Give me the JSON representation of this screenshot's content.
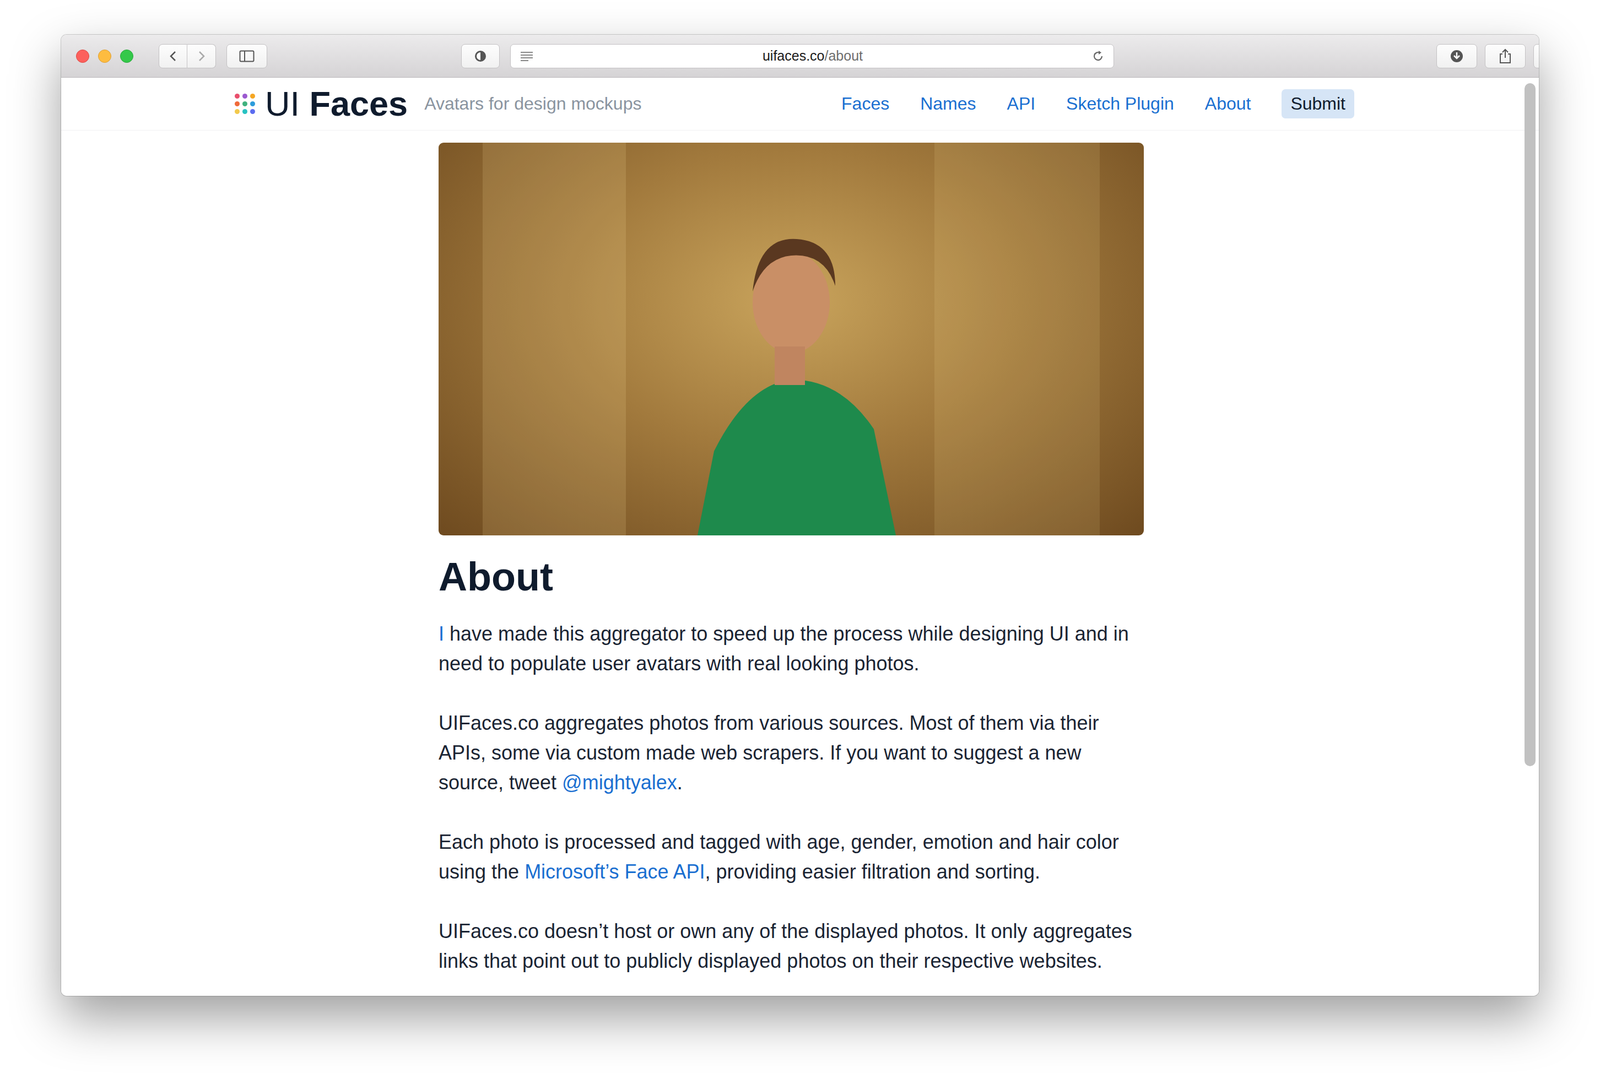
{
  "browser": {
    "address": {
      "domain": "uifaces.co",
      "path": "/about"
    }
  },
  "header": {
    "logo": {
      "prefix": "UI",
      "name": "Faces"
    },
    "tagline": "Avatars for design mockups",
    "nav": [
      {
        "label": "Faces",
        "kind": "link"
      },
      {
        "label": "Names",
        "kind": "link"
      },
      {
        "label": "API",
        "kind": "link"
      },
      {
        "label": "Sketch Plugin",
        "kind": "link"
      },
      {
        "label": "About",
        "kind": "link"
      },
      {
        "label": "Submit",
        "kind": "button"
      }
    ]
  },
  "page": {
    "heading": "About",
    "paragraphs": [
      [
        {
          "text": "I",
          "link": true
        },
        {
          "text": " have made this aggregator to speed up the process while designing UI and in need to populate user avatars with real looking photos.",
          "link": false
        }
      ],
      [
        {
          "text": "UIFaces.co aggregates photos from various sources. Most of them via their APIs, some via custom made web scrapers. If you want to suggest a new source, tweet ",
          "link": false
        },
        {
          "text": "@mightyalex",
          "link": true
        },
        {
          "text": ".",
          "link": false
        }
      ],
      [
        {
          "text": "Each photo is processed and tagged with age, gender, emotion and hair color using the ",
          "link": false
        },
        {
          "text": "Microsoft’s Face API",
          "link": true
        },
        {
          "text": ", providing easier filtration and sorting.",
          "link": false
        }
      ],
      [
        {
          "text": "UIFaces.co doesn’t host or own any of the displayed photos. It only aggregates links that point out to publicly displayed photos on their respective websites.",
          "link": false
        }
      ]
    ]
  }
}
